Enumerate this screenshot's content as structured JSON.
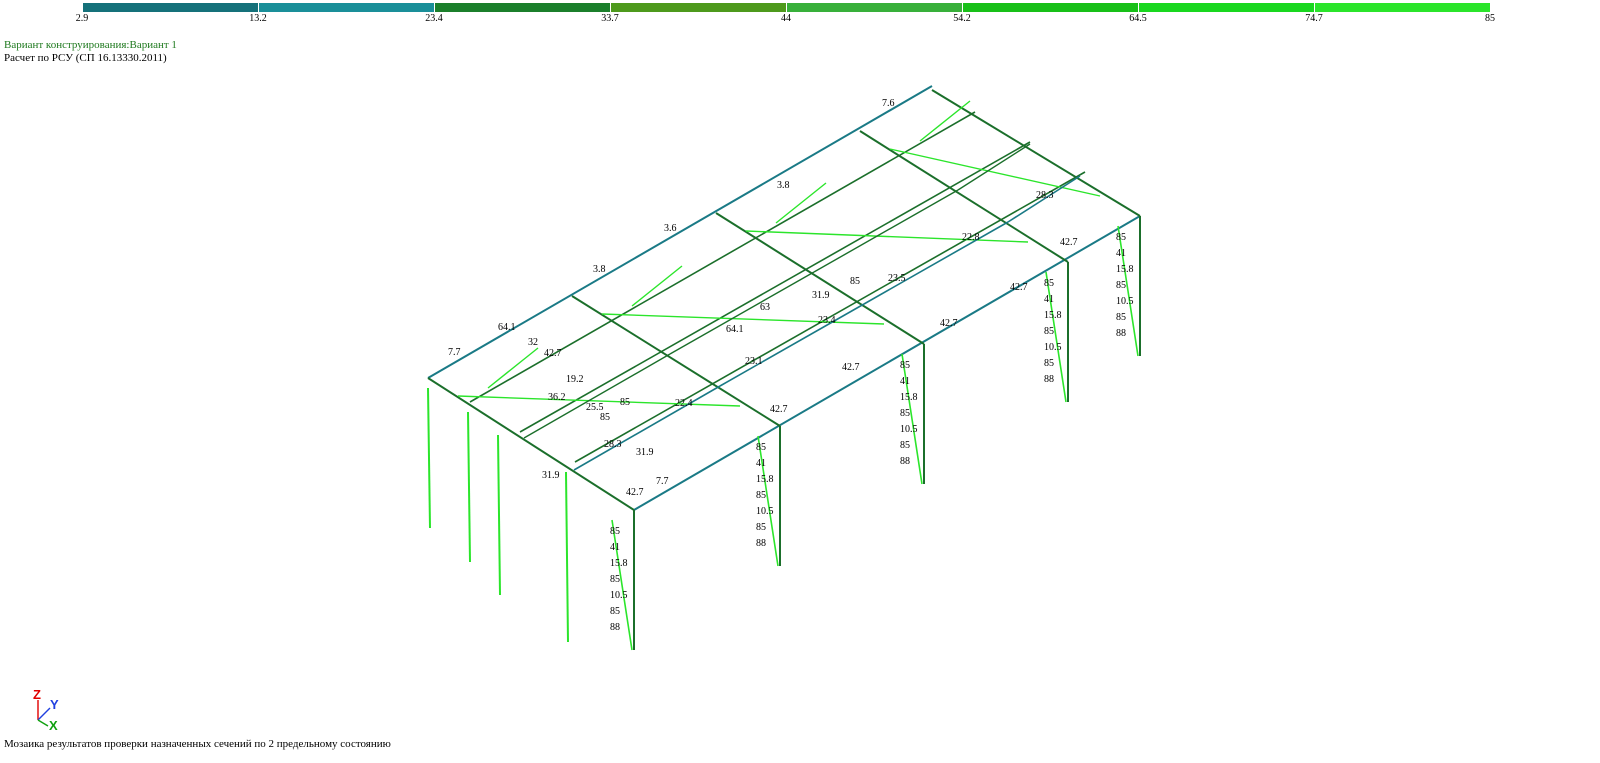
{
  "color_scale": {
    "ticks": [
      "2.9",
      "13.2",
      "23.4",
      "33.7",
      "44",
      "54.2",
      "64.5",
      "74.7",
      "85"
    ],
    "colors": [
      "#15717a",
      "#1a8f99",
      "#1b7f2b",
      "#4e9a1c",
      "#38b03a",
      "#18c018",
      "#19d81f",
      "#2be52b"
    ]
  },
  "header": {
    "variant": "Вариант конструирования:Вариант 1",
    "calc": "Расчет по РСУ (СП 16.13330.2011)"
  },
  "footer": "Мозаика результатов проверки назначенных сечений по 2 предельному состоянию",
  "axes": {
    "z": "Z",
    "y": "Y",
    "x": "X"
  },
  "frame": {
    "ridge_labels": [
      "7.6",
      "3.8",
      "3.6",
      "3.8",
      "7.7"
    ],
    "front_labels": [
      "42.7",
      "28.3",
      "31.9",
      "31.9",
      "42.7",
      "7.7"
    ],
    "beam_labels": [
      "22.8",
      "23.5",
      "23.4",
      "23.1",
      "22.4",
      "28.3",
      "42.7",
      "42.7",
      "42.7",
      "42.7"
    ],
    "column_labels": [
      "85",
      "41",
      "15.8",
      "85",
      "10.5",
      "85",
      "88"
    ],
    "roof_labels": [
      "64.1",
      "32",
      "42.7",
      "19.2",
      "36.2",
      "25.5",
      "85",
      "85",
      "64.1",
      "63",
      "31.9",
      "85"
    ]
  }
}
